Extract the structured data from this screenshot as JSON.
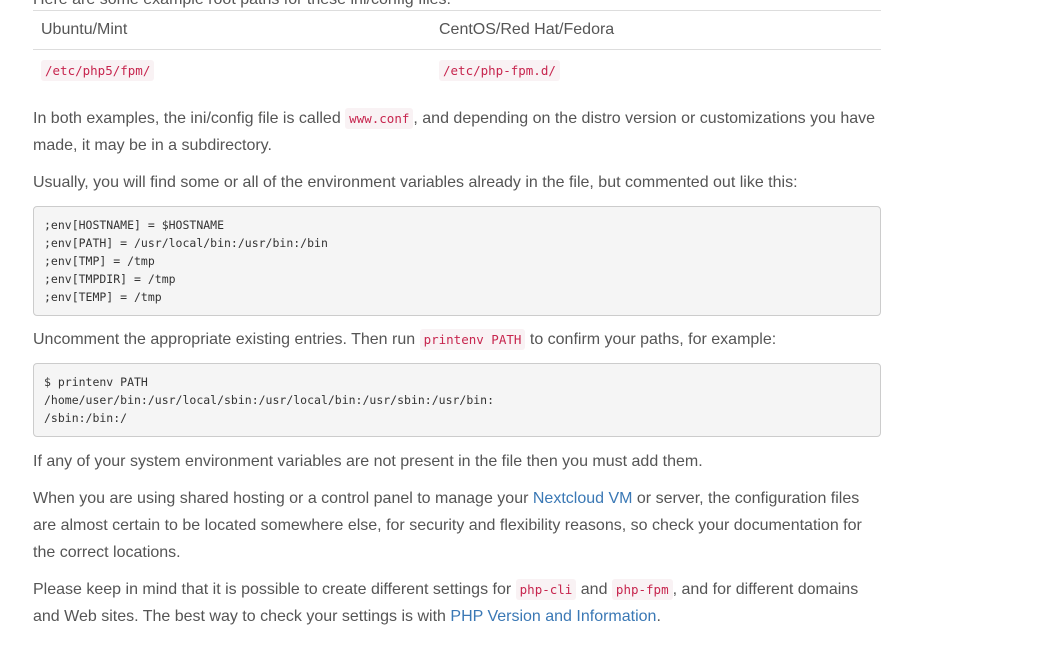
{
  "intro_cut": "Here are some example root paths for these ini/config files:",
  "table": {
    "headers": [
      "Ubuntu/Mint",
      "CentOS/Red Hat/Fedora"
    ],
    "paths": [
      "/etc/php5/fpm/",
      "/etc/php-fpm.d/"
    ]
  },
  "p1": {
    "before": "In both examples, the ini/config file is called ",
    "code": "www.conf",
    "after": ", and depending on the distro version or customizations you have made, it may be in a subdirectory."
  },
  "p2": "Usually, you will find some or all of the environment variables already in the file, but commented out like this:",
  "code_block_1": ";env[HOSTNAME] = $HOSTNAME\n;env[PATH] = /usr/local/bin:/usr/bin:/bin\n;env[TMP] = /tmp\n;env[TMPDIR] = /tmp\n;env[TEMP] = /tmp",
  "p3": {
    "before": "Uncomment the appropriate existing entries. Then run ",
    "code": "printenv PATH",
    "after": " to confirm your paths, for example:"
  },
  "code_block_2": "$ printenv PATH\n/home/user/bin:/usr/local/sbin:/usr/local/bin:/usr/sbin:/usr/bin:\n/sbin:/bin:/",
  "p4": "If any of your system environment variables are not present in the file then you must add them.",
  "p5": {
    "before": "When you are using shared hosting or a control panel to manage your ",
    "link": "Nextcloud VM",
    "after": " or server, the configuration files are almost certain to be located somewhere else, for security and flexibility reasons, so check your documentation for the correct locations."
  },
  "p6": {
    "before": "Please keep in mind that it is possible to create different settings for ",
    "code1": "php-cli",
    "middle": " and ",
    "code2": "php-fpm",
    "after": ", and for different domains and Web sites. The best way to check your settings is with ",
    "link": "PHP Version and Information",
    "end": "."
  },
  "colors": {
    "text": "#555555",
    "link": "#3a78b5",
    "code_text": "#c7254e",
    "code_bg": "#f9f2f4",
    "pre_bg": "#f5f5f5"
  }
}
